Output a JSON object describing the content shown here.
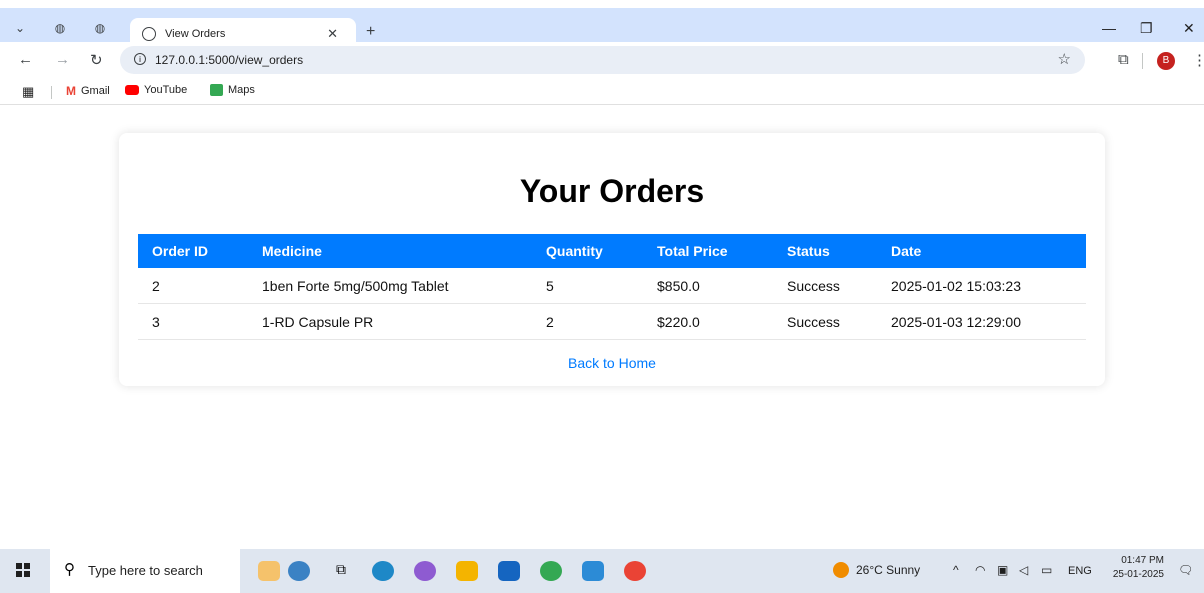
{
  "browser": {
    "tab_title": "View Orders",
    "url": "127.0.0.1:5000/view_orders",
    "profile_initial": "B",
    "bookmarks": [
      "Gmail",
      "YouTube",
      "Maps"
    ]
  },
  "page": {
    "title": "Your Orders",
    "columns": [
      "Order ID",
      "Medicine",
      "Quantity",
      "Total Price",
      "Status",
      "Date"
    ],
    "rows": [
      [
        "2",
        "1ben Forte 5mg/500mg Tablet",
        "5",
        "$850.0",
        "Success",
        "2025-01-02 15:03:23"
      ],
      [
        "3",
        "1-RD Capsule PR",
        "2",
        "$220.0",
        "Success",
        "2025-01-03 12:29:00"
      ]
    ],
    "back_link": "Back to Home",
    "accent_color": "#007bff"
  },
  "taskbar": {
    "search_placeholder": "Type here to search",
    "weather": "26°C  Sunny",
    "language": "ENG",
    "time": "01:47 PM",
    "date": "25-01-2025"
  }
}
